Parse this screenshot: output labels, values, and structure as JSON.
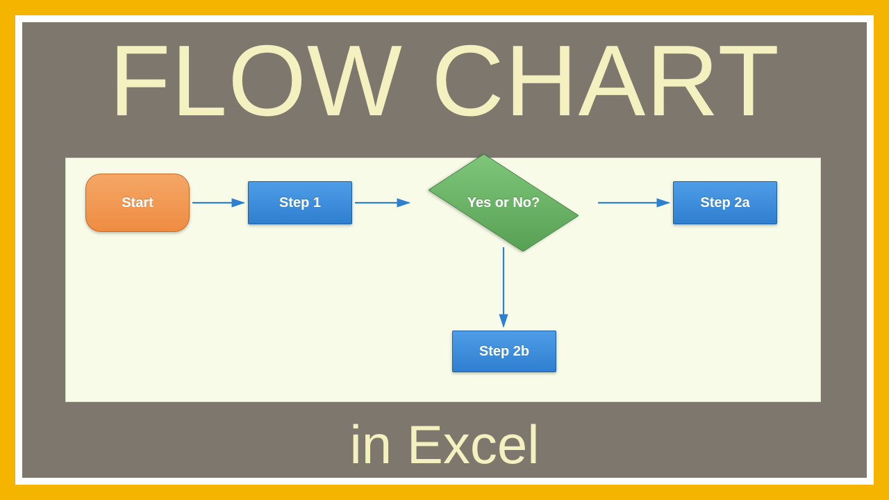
{
  "title": "FLOW CHART",
  "subtitle": "in Excel",
  "flow": {
    "start": "Start",
    "step1": "Step 1",
    "decision": "Yes or No?",
    "step2a": "Step 2a",
    "step2b": "Step 2b"
  },
  "colors": {
    "frame_outer": "#f4b400",
    "frame_inner": "#7d776d",
    "canvas": "#f7fbe8",
    "title_text": "#f5f0c0",
    "start_fill": "#ef8c42",
    "process_fill": "#2f7fd0",
    "decision_fill": "#57a054",
    "arrow": "#2f7fd0"
  }
}
